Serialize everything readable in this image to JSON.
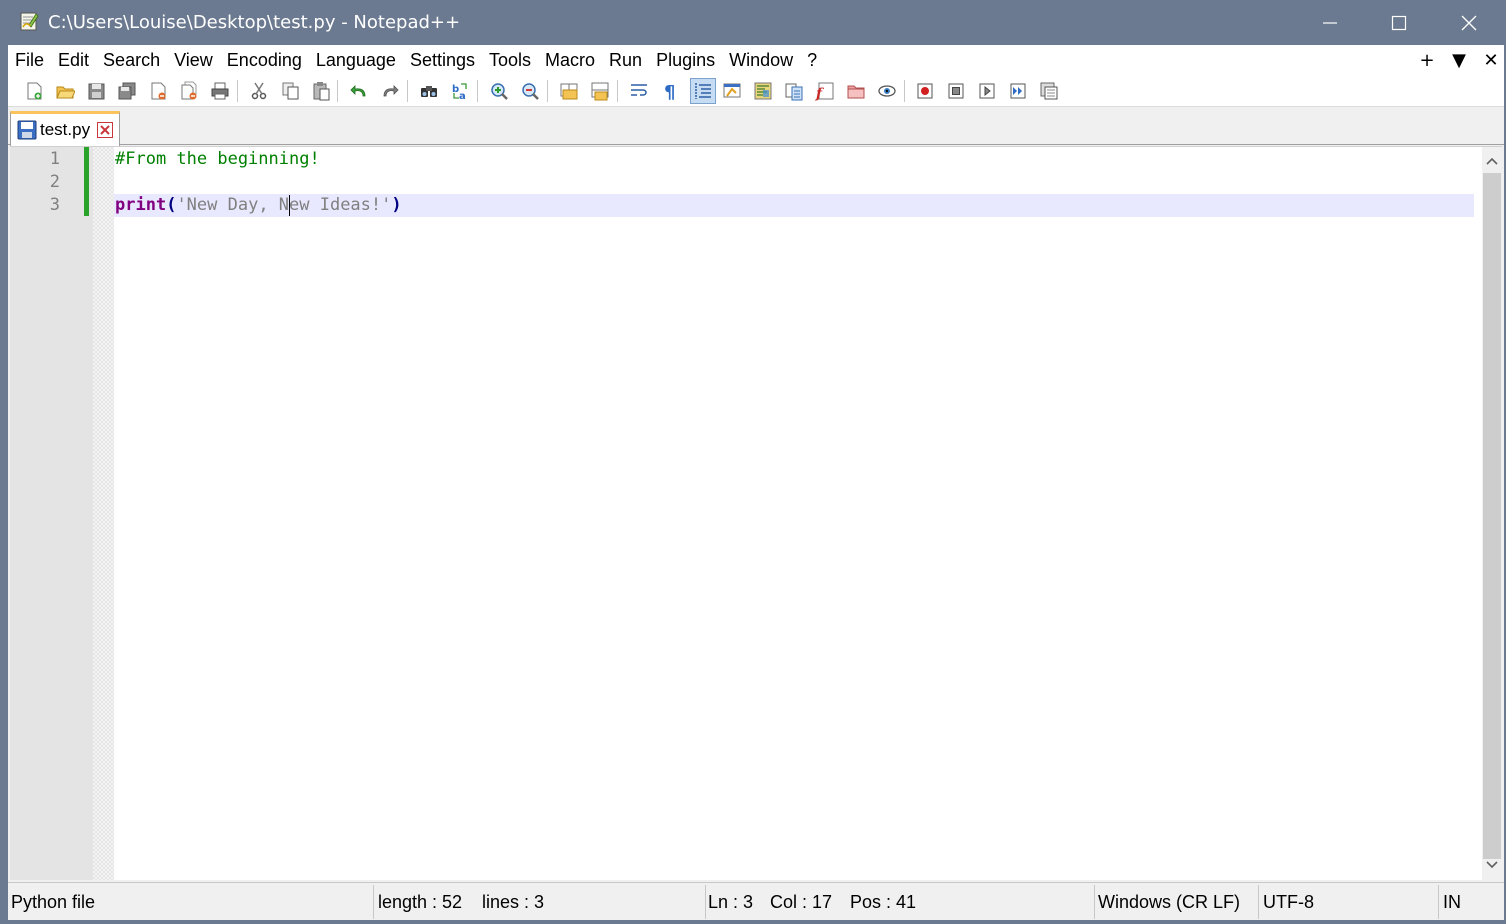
{
  "window": {
    "title": "C:\\Users\\Louise\\Desktop\\test.py - Notepad++",
    "titlebar_color": "#6b7a90"
  },
  "menu": {
    "items": [
      "File",
      "Edit",
      "Search",
      "View",
      "Encoding",
      "Language",
      "Settings",
      "Tools",
      "Macro",
      "Run",
      "Plugins",
      "Window",
      "?"
    ],
    "right_controls": [
      "+",
      "▼",
      "✕"
    ]
  },
  "toolbar": {
    "buttons": [
      "new-file-icon",
      "open-file-icon",
      "save-icon",
      "save-all-icon",
      "close-icon",
      "close-all-icon",
      "print-icon",
      "cut-icon",
      "copy-icon",
      "paste-icon",
      "undo-icon",
      "redo-icon",
      "find-icon",
      "replace-icon",
      "zoom-in-icon",
      "zoom-out-icon",
      "sync-vertical-icon",
      "sync-horizontal-icon",
      "word-wrap-icon",
      "show-all-chars-icon",
      "indent-guide-icon",
      "udl-icon",
      "doc-map-icon",
      "doc-list-icon",
      "function-list-icon",
      "folder-workspace-icon",
      "monitoring-icon",
      "record-macro-icon",
      "stop-macro-icon",
      "play-macro-icon",
      "run-macro-multiple-icon",
      "save-macro-icon"
    ],
    "active": "indent-guide-icon"
  },
  "tab": {
    "label": "test.py"
  },
  "editor": {
    "line_numbers": [
      "1",
      "2",
      "3"
    ],
    "lines": [
      [
        {
          "t": "#From the beginning!",
          "c": "comment"
        }
      ],
      [],
      [
        {
          "t": "print",
          "c": "keyword"
        },
        {
          "t": "(",
          "c": "op"
        },
        {
          "t": "'New Day, New Ideas!'",
          "c": "string"
        },
        {
          "t": ")",
          "c": "op"
        }
      ]
    ],
    "current_line": 3,
    "caret_col": 17,
    "colors": {
      "comment": "#008000",
      "keyword": "#800080",
      "string": "#808080",
      "current_line_bg": "#e8e8ff",
      "change_bar": "#2aa32a"
    }
  },
  "status": {
    "file_type": "Python file",
    "length": "length : 52",
    "lines": "lines : 3",
    "ln": "Ln : 3",
    "col": "Col : 17",
    "pos": "Pos : 41",
    "eol": "Windows (CR LF)",
    "encoding": "UTF-8",
    "mode": "IN"
  }
}
